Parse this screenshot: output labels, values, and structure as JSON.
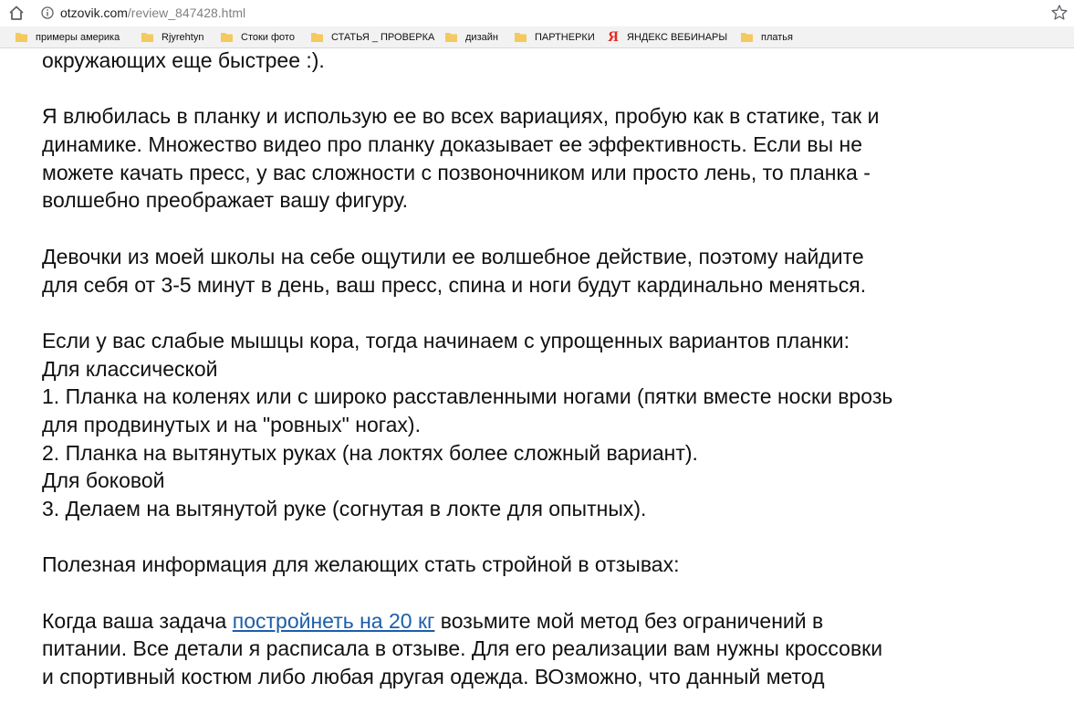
{
  "browser": {
    "url_domain": "otzovik.com",
    "url_path": "/review_847428.html",
    "bookmarks": [
      {
        "label": "примеры америка",
        "icon": "folder-icon"
      },
      {
        "label": "Rjyrehtyn",
        "icon": "folder-icon"
      },
      {
        "label": "Стоки фото",
        "icon": "folder-icon"
      },
      {
        "label": "СТАТЬЯ _ ПРОВЕРКА",
        "icon": "folder-icon"
      },
      {
        "label": "дизайн",
        "icon": "folder-icon"
      },
      {
        "label": "ПАРТНЕРКИ",
        "icon": "folder-icon"
      },
      {
        "label": "ЯНДЕКС ВЕБИНАРЫ",
        "icon": "yandex-icon"
      },
      {
        "label": "платья",
        "icon": "folder-icon"
      }
    ]
  },
  "article": {
    "p0_l1": "окружающих еще быстрее :).",
    "p1_l1": "Я влюбилась в планку и использую ее во всех вариациях, пробую как в статике, так и",
    "p1_l2": "динамике. Множество видео про планку доказывает ее эффективность. Если вы не",
    "p1_l3": "можете качать пресс, у вас сложности с позвоночником или просто лень, то планка -",
    "p1_l4": "волшебно преображает вашу фигуру.",
    "p2_l1": "Девочки из моей школы на себе ощутили ее волшебное действие, поэтому найдите",
    "p2_l2": "для себя от 3-5 минут в день, ваш пресс, спина и ноги будут кардинально меняться.",
    "p3_l1": "Если у вас слабые мышцы кора, тогда начинаем с упрощенных вариантов планки:",
    "p3_l2": "Для классической",
    "p3_l3": "1. Планка на коленях или с широко расставленными ногами (пятки вместе носки врозь",
    "p3_l4": "для продвинутых и на \"ровных\" ногах).",
    "p3_l5": "2. Планка на вытянутых руках (на локтях более сложный вариант).",
    "p3_l6": "Для боковой",
    "p3_l7": "3. Делаем на вытянутой руке (согнутая в локте для опытных).",
    "p4_l1": "Полезная информация для желающих стать стройной в отзывах:",
    "p5_l1_before": "Когда ваша задача ",
    "p5_l1_link": "постройнеть на 20 кг",
    "p5_l1_after": " возьмите мой метод без ограничений в",
    "p5_l2": "питании. Все детали я расписала в отзыве. Для его реализации вам нужны кроссовки",
    "p5_l3": "и спортивный костюм либо любая другая одежда. ВОзможно, что данный метод"
  },
  "colors": {
    "text": "#111111",
    "link": "#1c5ea8",
    "bookmarks_bar": "#f2f2f2",
    "folder": "#f4c95d",
    "yandex": "#e52620"
  }
}
